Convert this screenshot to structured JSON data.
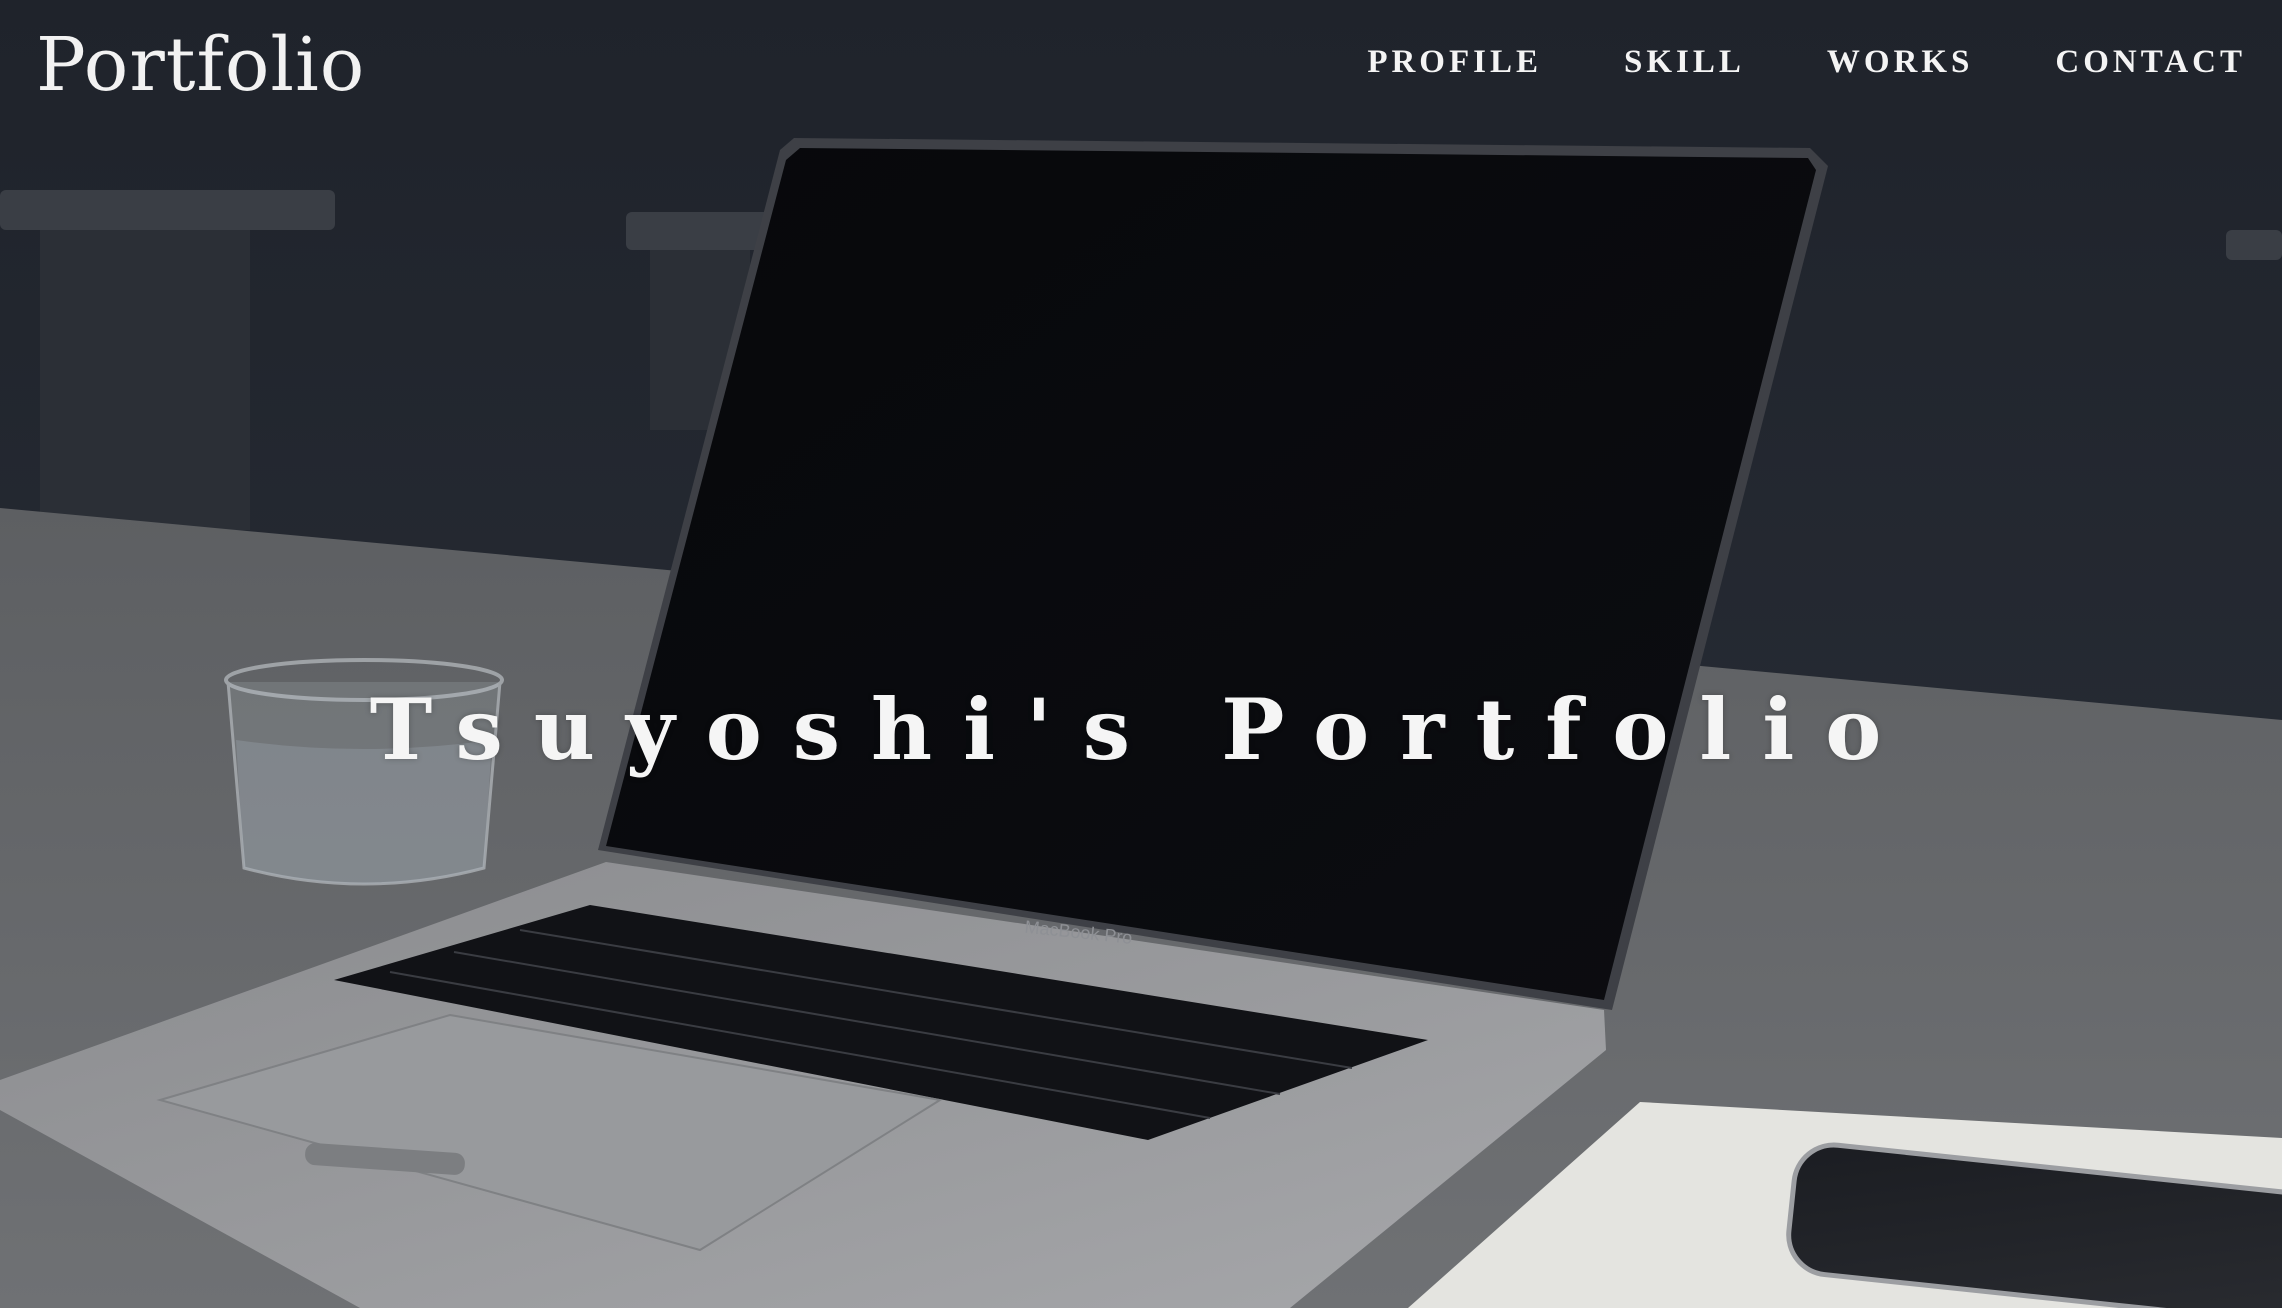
{
  "header": {
    "logo": "Portfolio",
    "nav": [
      {
        "label": "PROFILE"
      },
      {
        "label": "SKILL"
      },
      {
        "label": "WORKS"
      },
      {
        "label": "CONTACT"
      }
    ]
  },
  "hero": {
    "title": "Tsuyoshi's Portfolio",
    "laptop_brand": "MacBook Pro"
  },
  "colors": {
    "text": "#f4f4f4",
    "wall": "#22262e",
    "table": "#6b6d70"
  }
}
